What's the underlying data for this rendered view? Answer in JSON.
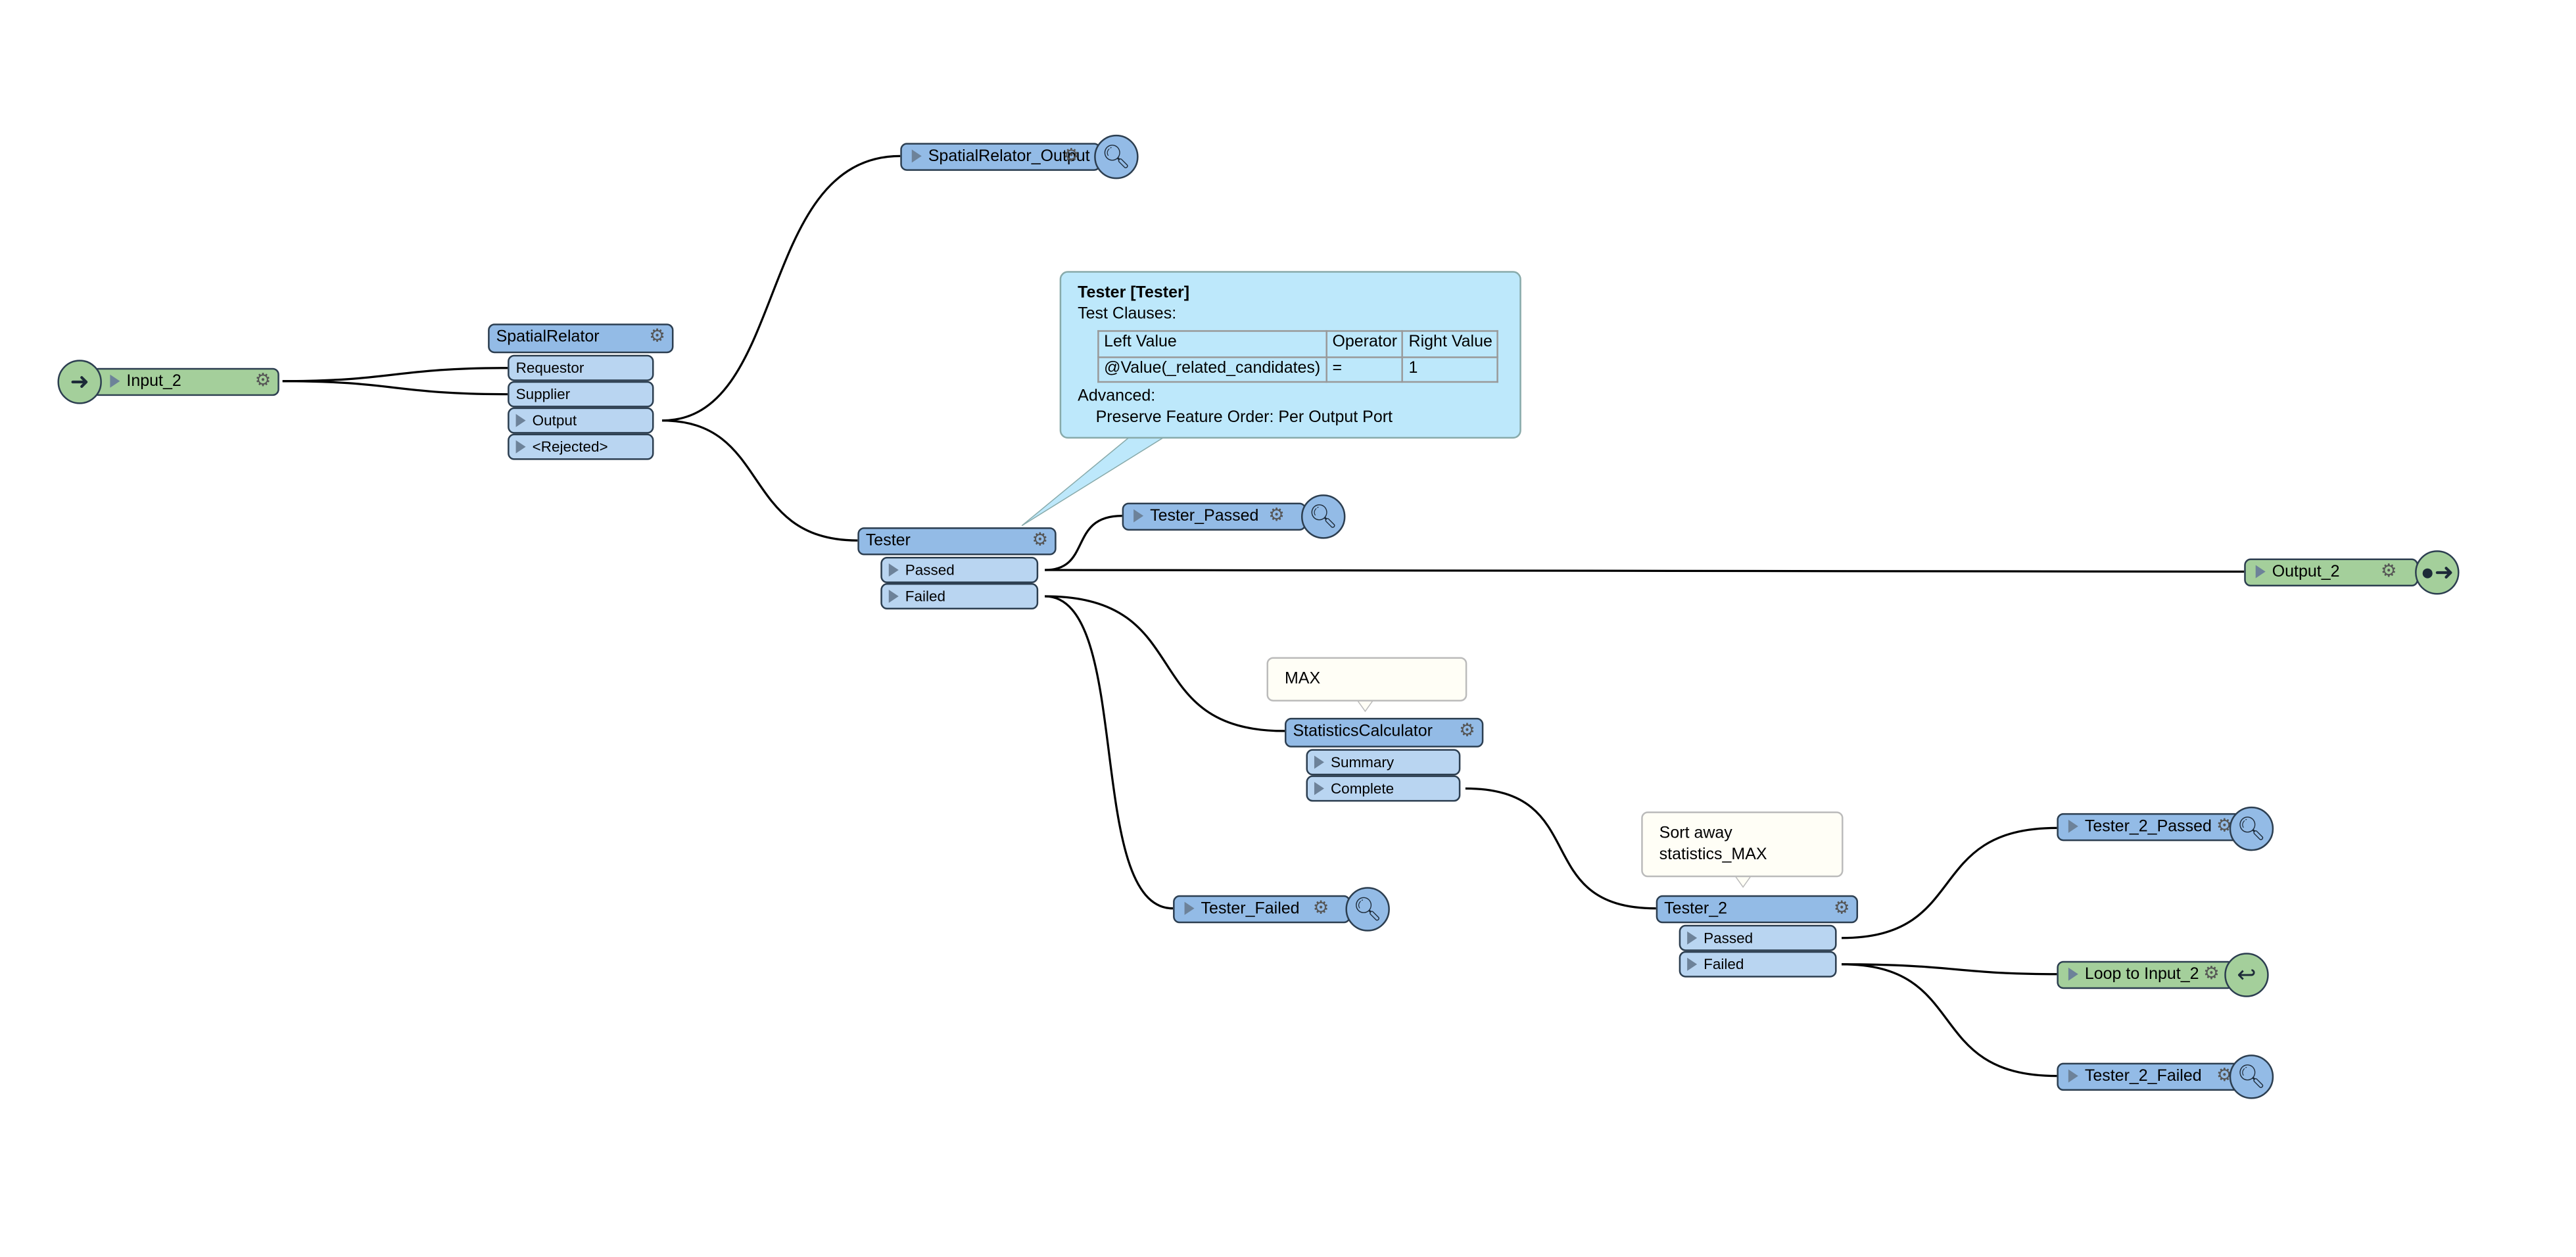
{
  "nodes": {
    "input_2": {
      "label": "Input_2",
      "icon": "reader-input-icon"
    },
    "spatial_relator": {
      "label": "SpatialRelator",
      "inputs": [
        "Requestor",
        "Supplier"
      ],
      "outputs": [
        "Output",
        "<Rejected>"
      ]
    },
    "spatial_relator_output": {
      "label": "SpatialRelator_Output",
      "icon": "magnifier-icon"
    },
    "tester": {
      "label": "Tester",
      "outputs": [
        "Passed",
        "Failed"
      ]
    },
    "tester_passed": {
      "label": "Tester_Passed",
      "icon": "magnifier-icon"
    },
    "output_2": {
      "label": "Output_2",
      "icon": "writer-output-icon"
    },
    "tester_failed": {
      "label": "Tester_Failed",
      "icon": "magnifier-icon"
    },
    "statistics_calculator": {
      "label": "StatisticsCalculator",
      "outputs": [
        "Summary",
        "Complete"
      ]
    },
    "tester_2": {
      "label": "Tester_2",
      "outputs": [
        "Passed",
        "Failed"
      ]
    },
    "tester_2_passed": {
      "label": "Tester_2_Passed",
      "icon": "magnifier-icon"
    },
    "loop_to_input_2": {
      "label": "Loop to Input_2",
      "icon": "loop-icon"
    },
    "tester_2_failed": {
      "label": "Tester_2_Failed",
      "icon": "magnifier-icon"
    }
  },
  "annotations": {
    "max": "MAX",
    "sort_line1": "Sort away",
    "sort_line2": "statistics_MAX"
  },
  "tooltip": {
    "title": "Tester [Tester]",
    "clauses_label": "Test Clauses:",
    "columns": [
      "Left Value",
      "Operator",
      "Right Value"
    ],
    "row": [
      "@Value(_related_candidates)",
      "=",
      "1"
    ],
    "advanced_label": "Advanced:",
    "advanced_value": "Preserve Feature Order: Per Output Port"
  },
  "colors": {
    "transformer": "#93bbe6",
    "port": "#b9d5f1",
    "reader_writer": "#a4cf9b",
    "tooltip": "#bde8fb"
  }
}
